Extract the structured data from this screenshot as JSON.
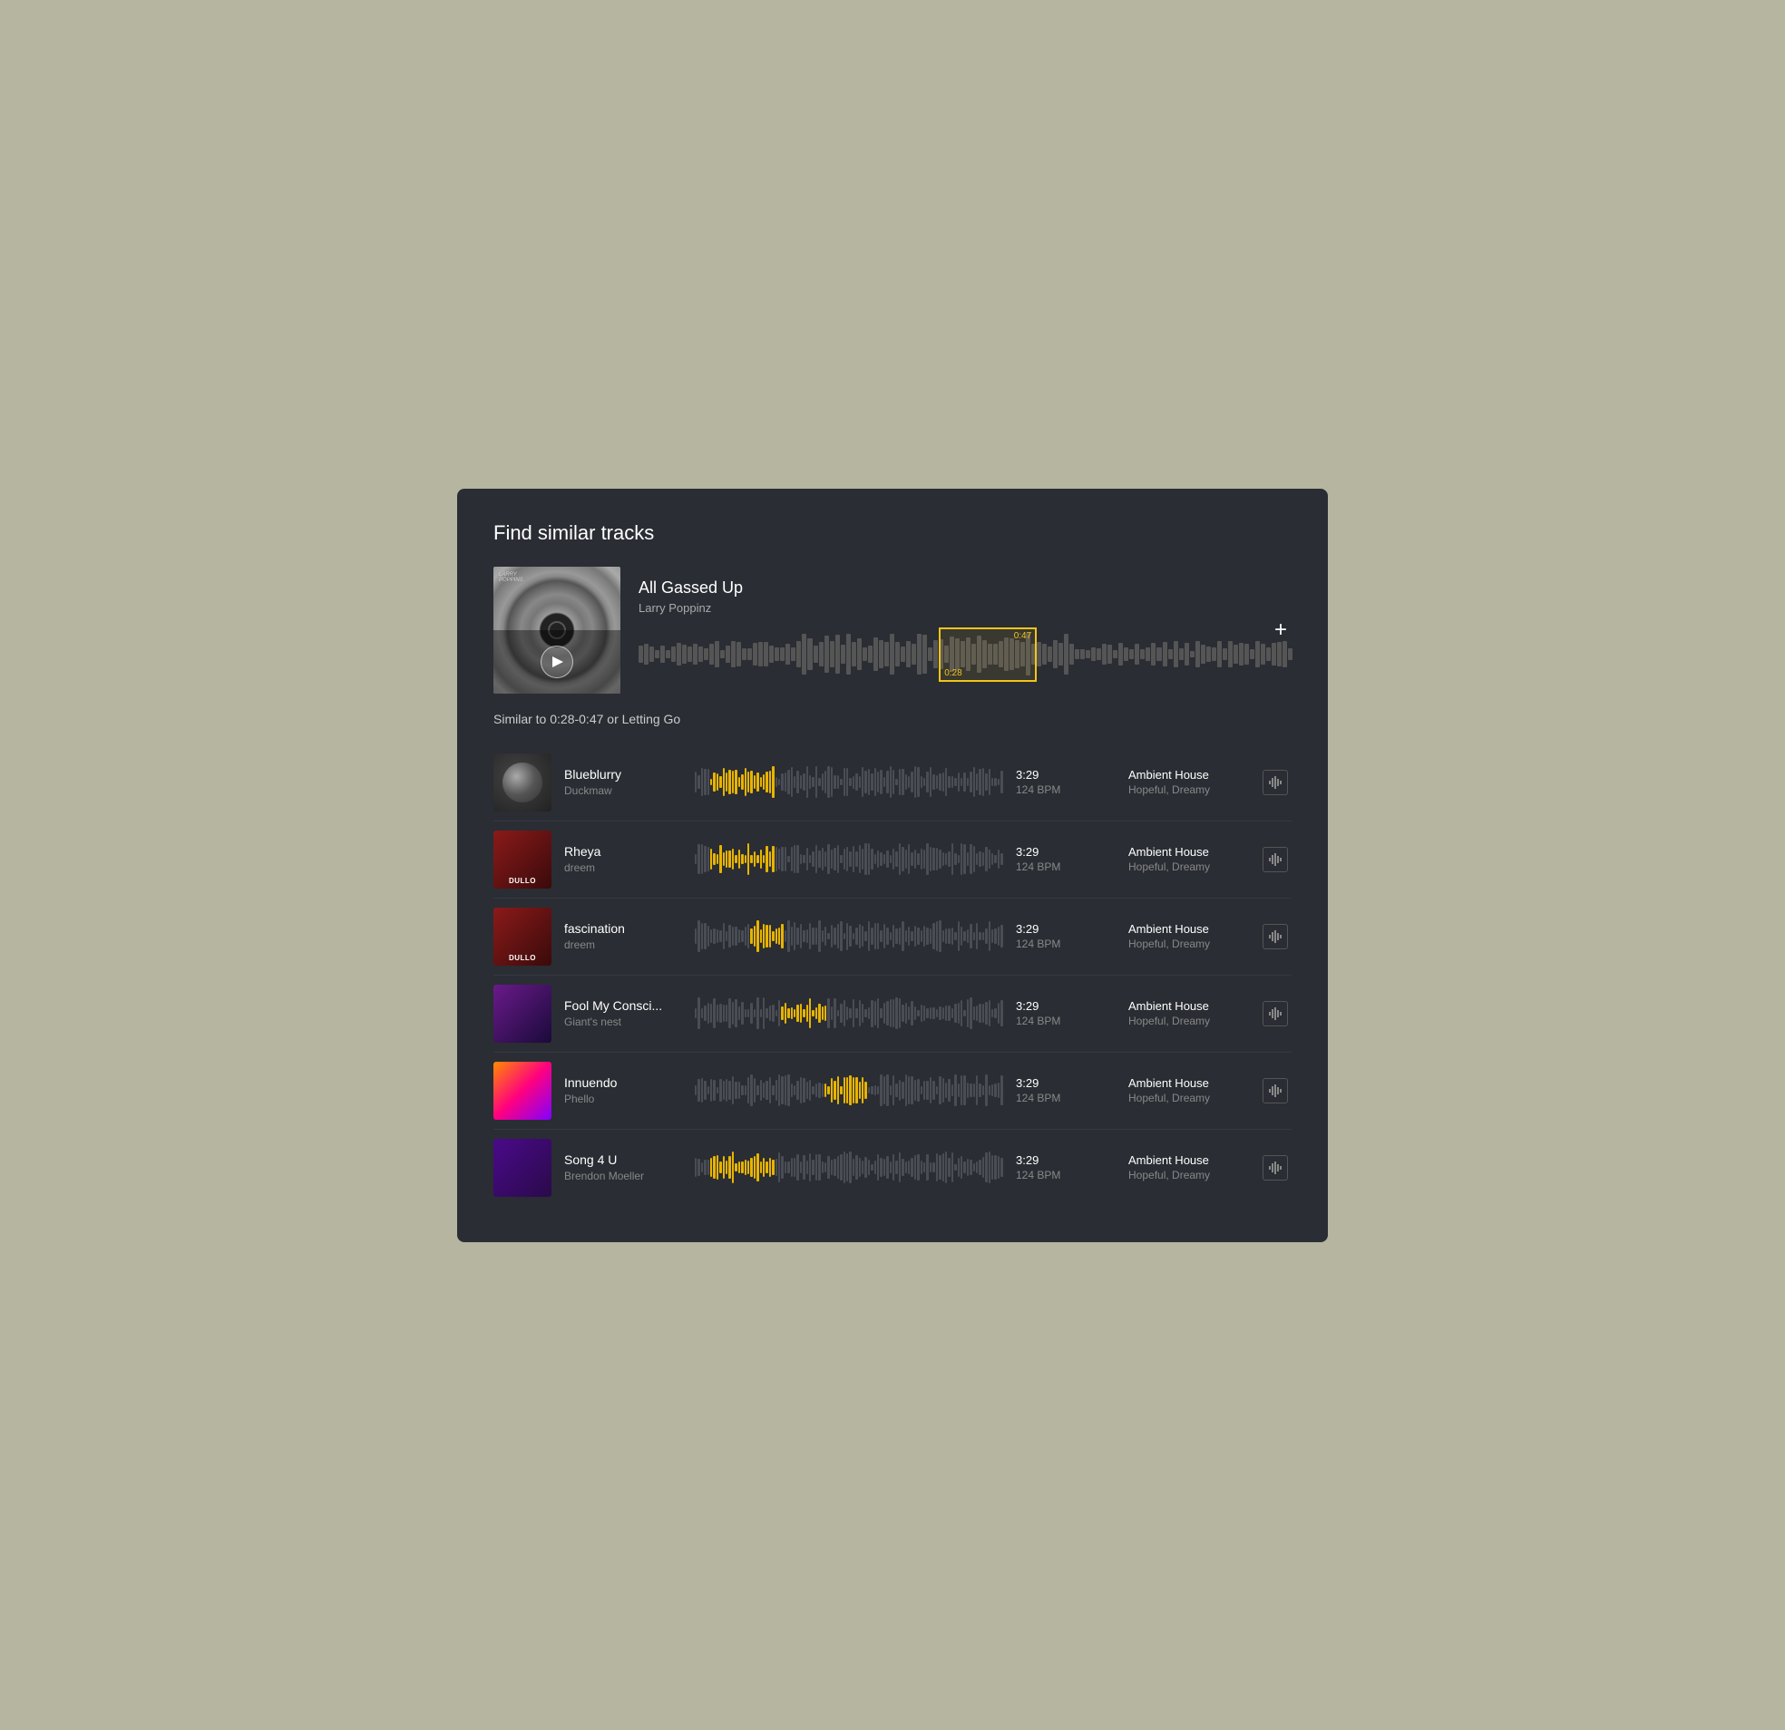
{
  "page": {
    "title": "Find similar tracks",
    "background": "#2a2d33"
  },
  "hero": {
    "title": "All Gassed Up",
    "artist": "Larry Poppinz",
    "play_label": "play",
    "selection_start": "0:28",
    "selection_end": "0:47",
    "add_button": "+"
  },
  "similar_label": "Similar to 0:28-0:47 or Letting Go",
  "tracks": [
    {
      "id": 1,
      "name": "Blueblurry",
      "artist": "Duckmaw",
      "duration": "3:29",
      "bpm": "124 BPM",
      "genre": "Ambient House",
      "mood": "Hopeful, Dreamy",
      "highlight_pos": "early",
      "thumb_type": "globe"
    },
    {
      "id": 2,
      "name": "Rheya",
      "artist": "dreem",
      "duration": "3:29",
      "bpm": "124 BPM",
      "genre": "Ambient House",
      "mood": "Hopeful, Dreamy",
      "highlight_pos": "early",
      "thumb_type": "red_text"
    },
    {
      "id": 3,
      "name": "fascination",
      "artist": "dreem",
      "duration": "3:29",
      "bpm": "124 BPM",
      "genre": "Ambient House",
      "mood": "Hopeful, Dreamy",
      "highlight_pos": "early_mid",
      "thumb_type": "red_text"
    },
    {
      "id": 4,
      "name": "Fool My Consci...",
      "artist": "Giant's nest",
      "duration": "3:29",
      "bpm": "124 BPM",
      "genre": "Ambient House",
      "mood": "Hopeful, Dreamy",
      "highlight_pos": "mid",
      "thumb_type": "purple"
    },
    {
      "id": 5,
      "name": "Innuendo",
      "artist": "Phello",
      "duration": "3:29",
      "bpm": "124 BPM",
      "genre": "Ambient House",
      "mood": "Hopeful, Dreamy",
      "highlight_pos": "mid_late",
      "thumb_type": "rainbow"
    },
    {
      "id": 6,
      "name": "Song 4 U",
      "artist": "Brendon Moeller",
      "duration": "3:29",
      "bpm": "124 BPM",
      "genre": "Ambient House",
      "mood": "Hopeful, Dreamy",
      "highlight_pos": "early",
      "thumb_type": "dark_purple"
    }
  ]
}
